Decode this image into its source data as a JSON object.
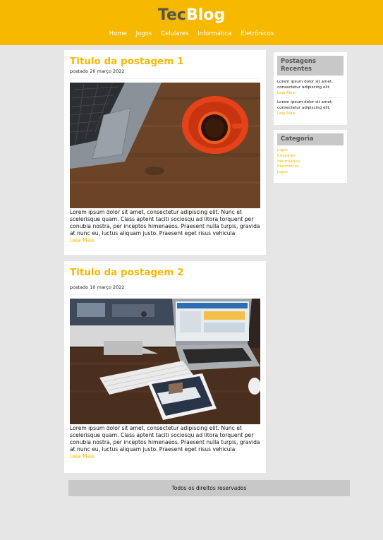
{
  "header": {
    "logo_part1": "Tec",
    "logo_part2": "Blog",
    "nav": [
      "Home",
      "Jogos",
      "Celulares",
      "Informática",
      "Eletrônicos"
    ]
  },
  "posts": [
    {
      "title": "Titulo da postagem 1",
      "date": "postado 20 março 2022",
      "image": "laptop-and-coffee-photo",
      "text": "Lorem ipsum dolor sit amet, consectetur adipiscing elit. Nunc et scelerisque quam. Class aptent taciti sociosqu ad litora torquent per conubia nostra, per inceptos himenaeos. Praesent nulla turpis, gravida at nunc eu, luctus aliquam justo. Praesent eget risus vehicula",
      "read_more": "Leia Mais"
    },
    {
      "title": "Titulo da postagem 2",
      "date": "postado 10 março 2022",
      "image": "computers-and-tablet-photo",
      "text": "Lorem ipsum dolor sit amet, consectetur adipiscing elit. Nunc et scelerisque quam. Class aptent taciti sociosqu ad litora torquent per conubia nostra, per inceptos himenaeos. Praesent nulla turpis, gravida at nunc eu, luctus aliquam justo. Praesent eget risus vehicula",
      "read_more": "Leia Mais"
    }
  ],
  "sidebar": {
    "recent": {
      "title": "Postagens Recentes",
      "items": [
        {
          "text": "Lorem ipsum dolor sit amet, consectetur adipiscing elit.",
          "link": "Leia Mais"
        },
        {
          "text": "Lorem ipsum dolor sit amet, consectetur adipiscing elit.",
          "link": "Leia Mais"
        }
      ]
    },
    "categories": {
      "title": "Categoria",
      "items": [
        "Jogos",
        "Celulares",
        "Informática",
        "Eletrônicos",
        "Jogos"
      ]
    }
  },
  "footer": {
    "text": "Todos os direitos reservados"
  },
  "colors": {
    "accent": "#f7b800",
    "background": "#e6e6e6",
    "panel": "#c8c8c8"
  }
}
